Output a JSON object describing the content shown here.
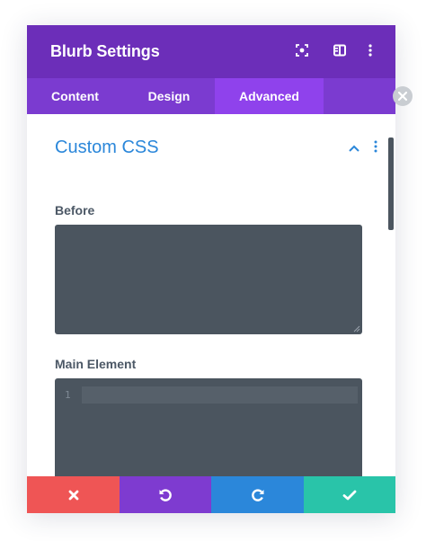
{
  "modal": {
    "title": "Blurb Settings"
  },
  "header_icons": [
    "expand-icon",
    "split-view-icon",
    "more-options-icon"
  ],
  "tabs": [
    {
      "label": "Content",
      "active": false
    },
    {
      "label": "Design",
      "active": false
    },
    {
      "label": "Advanced",
      "active": true
    }
  ],
  "section": {
    "title": "Custom CSS"
  },
  "fields": {
    "before": {
      "label": "Before",
      "value": ""
    },
    "main_element": {
      "label": "Main Element",
      "line_number": "1",
      "value": ""
    }
  },
  "footer_buttons": [
    {
      "name": "discard-button",
      "icon": "x-icon",
      "color": "#ef5555"
    },
    {
      "name": "undo-button",
      "icon": "undo-icon",
      "color": "#7e3bd0"
    },
    {
      "name": "redo-button",
      "icon": "redo-icon",
      "color": "#2b87da"
    },
    {
      "name": "save-button",
      "icon": "check-icon",
      "color": "#29c4a9"
    }
  ],
  "colors": {
    "header": "#6c2eb9",
    "tabs": "#7b3bd0",
    "tab_active": "#8f42ec",
    "section_title": "#2b87da",
    "code_bg": "#4b555f"
  }
}
